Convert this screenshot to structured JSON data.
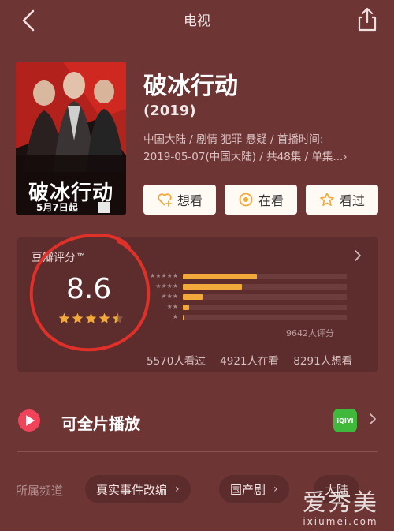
{
  "header": {
    "title": "电视"
  },
  "poster": {
    "title": "破冰行动",
    "date": "5月7日起"
  },
  "movie": {
    "title": "破冰行动",
    "year": "(2019)",
    "meta_line1": "中国大陆 / 剧情 犯罪 悬疑 / 首播时间:",
    "meta_line2": "2019-05-07(中国大陆) / 共48集 / 单集...›"
  },
  "actions": [
    {
      "label": "想看",
      "icon": "heart-plus-icon"
    },
    {
      "label": "在看",
      "icon": "target-icon"
    },
    {
      "label": "看过",
      "icon": "star-outline-icon"
    }
  ],
  "rating": {
    "label": "豆瓣评分™",
    "score": "8.6",
    "stars_filled": 4.5,
    "distribution_pct": [
      45,
      36,
      12,
      4,
      1
    ],
    "votes": "9642人评分",
    "watched": "5570人看过",
    "watching": "4921人在看",
    "want": "8291人想看"
  },
  "playback": {
    "label": "可全片播放",
    "platform": "iQIYI"
  },
  "channels": {
    "label": "所属频道",
    "tags": [
      "真实事件改编",
      "国产剧",
      "大陆"
    ]
  },
  "watermark": {
    "main": "爱秀美",
    "sub": "ixiumei.com"
  },
  "colors": {
    "background": "#6e3535",
    "card": "#5d2d2d",
    "bar": "#f2a93c",
    "star": "#f2a93c",
    "circle": "#e0302a"
  }
}
